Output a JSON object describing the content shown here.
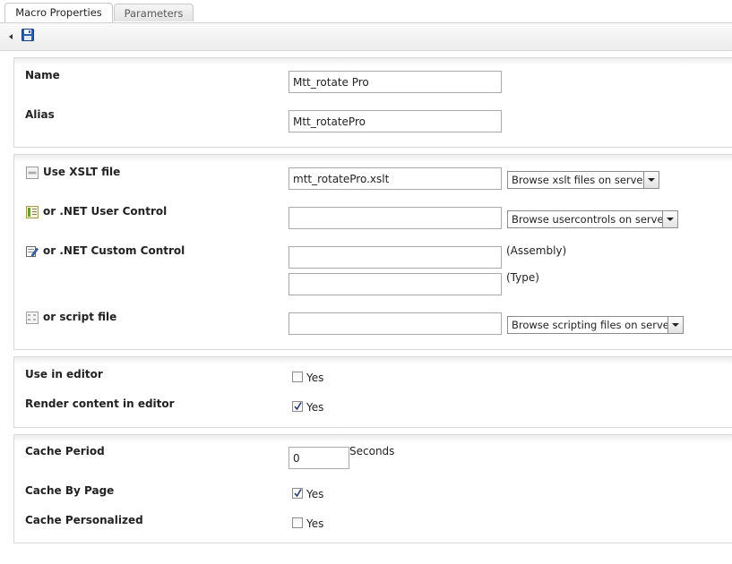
{
  "tabs": [
    {
      "label": "Macro Properties",
      "active": true
    },
    {
      "label": "Parameters",
      "active": false
    }
  ],
  "toolbar": {
    "save_icon": "floppy-disk-icon"
  },
  "names": {
    "name_label": "Name",
    "name_value": "Mtt_rotate Pro",
    "alias_label": "Alias",
    "alias_value": "Mtt_rotatePro"
  },
  "render": {
    "xslt_label": "Use XSLT file",
    "xslt_value": "mtt_rotatePro.xslt",
    "xslt_browse": "Browse xslt files on server...",
    "usercontrol_label": "or .NET User Control",
    "usercontrol_value": "",
    "usercontrol_browse": "Browse usercontrols on server...",
    "customcontrol_label": "or .NET Custom Control",
    "assembly_value": "",
    "assembly_hint": "(Assembly)",
    "type_value": "",
    "type_hint": "(Type)",
    "script_label": "or script file",
    "script_value": "",
    "script_browse": "Browse scripting files on server..."
  },
  "editor": {
    "use_in_editor_label": "Use in editor",
    "use_in_editor_checked": false,
    "use_in_editor_yes": "Yes",
    "render_content_label": "Render content in editor",
    "render_content_checked": true,
    "render_content_yes": "Yes"
  },
  "cache": {
    "period_label": "Cache Period",
    "period_value": "0",
    "period_unit": "Seconds",
    "by_page_label": "Cache By Page",
    "by_page_checked": true,
    "by_page_yes": "Yes",
    "personalized_label": "Cache Personalized",
    "personalized_checked": false,
    "personalized_yes": "Yes"
  }
}
